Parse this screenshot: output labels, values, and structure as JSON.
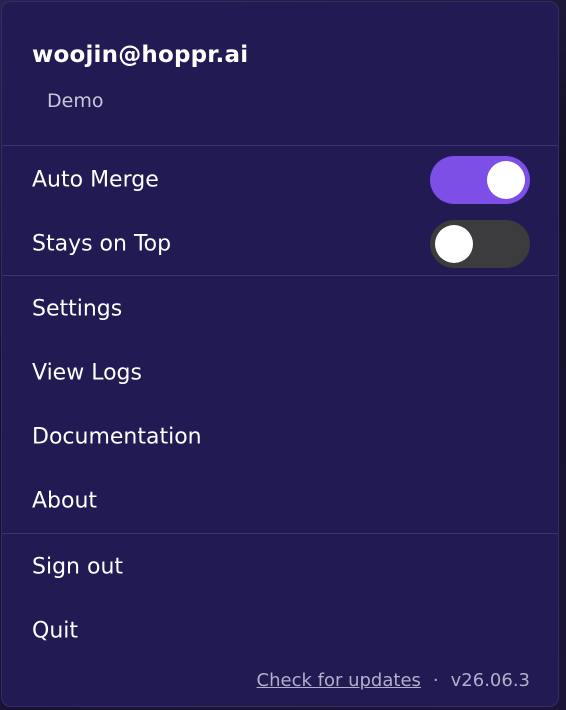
{
  "account": {
    "email": "woojin@hoppr.ai",
    "org": "Demo"
  },
  "toggles": [
    {
      "label": "Auto Merge",
      "state": "on"
    },
    {
      "label": "Stays on Top",
      "state": "off"
    }
  ],
  "menu_items": [
    {
      "label": "Settings"
    },
    {
      "label": "View Logs"
    },
    {
      "label": "Documentation"
    },
    {
      "label": "About"
    }
  ],
  "session_items": [
    {
      "label": "Sign out"
    },
    {
      "label": "Quit"
    }
  ],
  "footer": {
    "check_updates": "Check for updates",
    "separator": "·",
    "version": "v26.06.3"
  },
  "colors": {
    "menu_background": "#221a52",
    "toggle_on": "#7e4fe6",
    "toggle_off": "#3c3c3e"
  }
}
